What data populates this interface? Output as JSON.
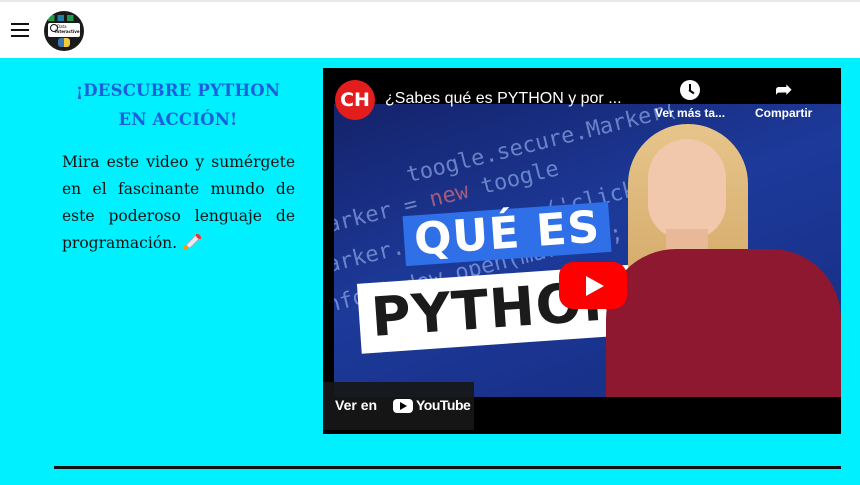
{
  "header": {
    "menu_icon": "hamburger-menu-icon",
    "logo_text_line1": "Data",
    "logo_text_line2": "Interactive"
  },
  "intro": {
    "heading": "¡DESCUBRE PYTHON EN ACCIÓN!",
    "paragraph": "Mira este video y sumérgete en el fascinante mundo de este poderoso lenguaje de programación.",
    "emoji_icon": "rocket-icon"
  },
  "video": {
    "channel_logo_text": "CH",
    "title": "¿Sabes qué es PYTHON y por ...",
    "watch_later_label": "Ver más ta...",
    "share_label": "Compartir",
    "thumbnail_line1": "QUÉ ES",
    "thumbnail_line2": "PYTHON",
    "watch_on_label": "Ver en",
    "watch_on_brand": "YouTube"
  },
  "colors": {
    "section_bg": "#00f0ff",
    "heading": "#1a5fe0",
    "play_button": "#ff0000"
  }
}
